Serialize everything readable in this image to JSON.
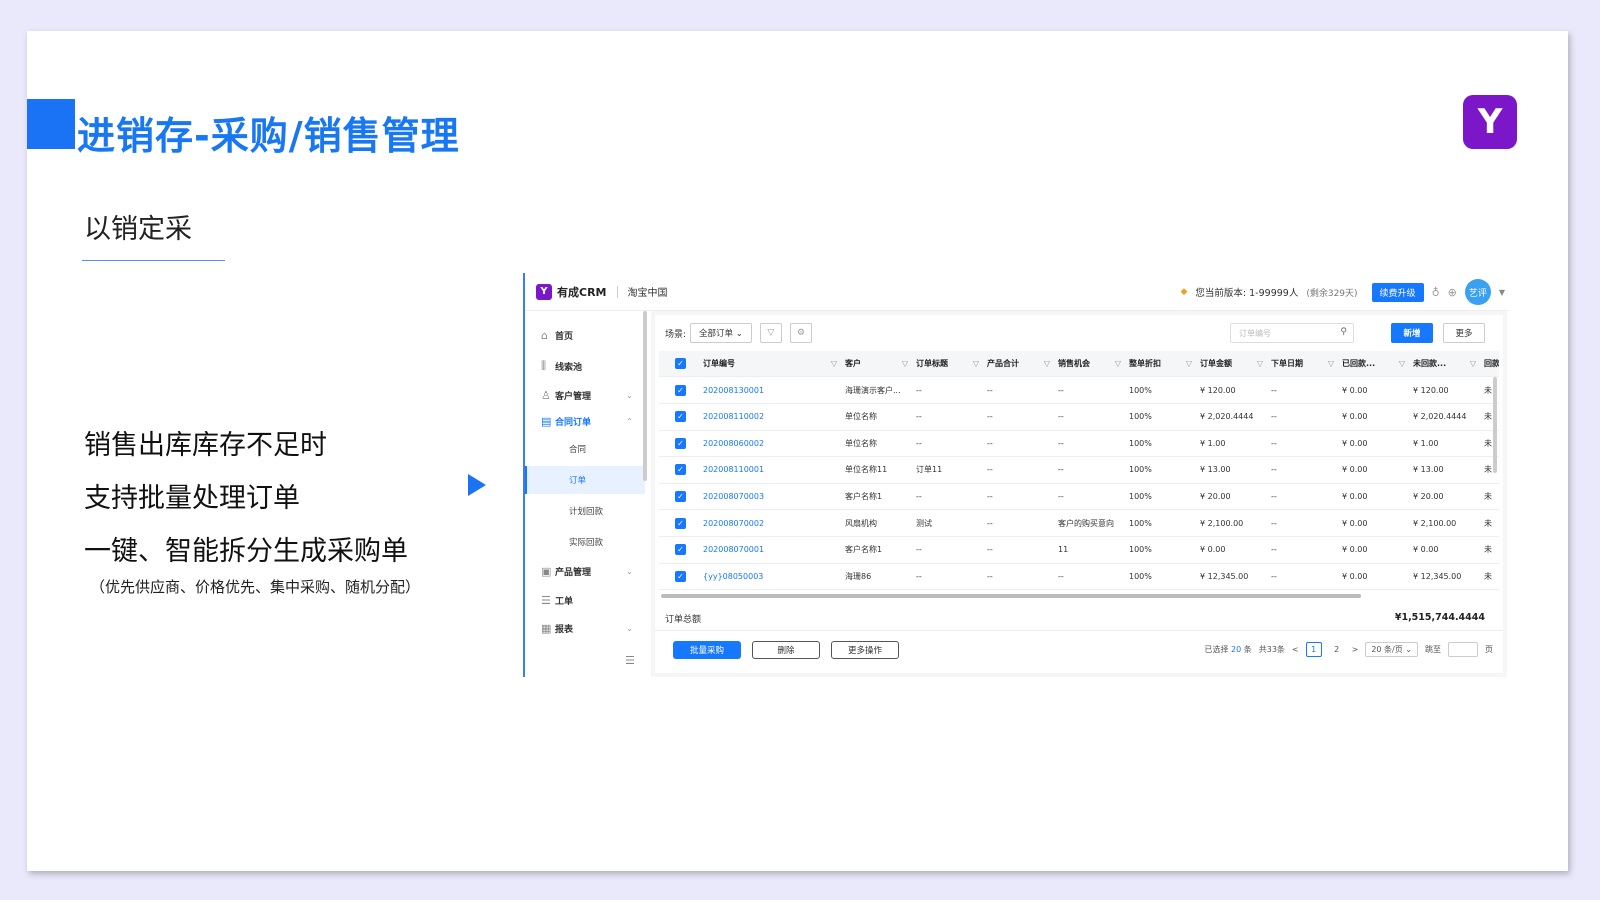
{
  "slide": {
    "title": "进销存-采购/销售管理",
    "logo_glyph": "Y",
    "subheading": "以销定采",
    "bullets": [
      "销售出库库存不足时",
      "支持批量处理订单",
      "一键、智能拆分生成采购单"
    ],
    "note": "（优先供应商、价格优先、集中采购、随机分配）",
    "accent_color": "#1a73f5"
  },
  "app": {
    "name": "有成CRM",
    "logo_glyph": "Y",
    "company": "淘宝中国",
    "version_text": "您当前版本: 1-99999人",
    "version_remaining": "(剩余329天)",
    "upgrade_label": "续费升级",
    "avatar_text": "艺评",
    "icons": [
      "shirt-icon",
      "globe-icon",
      "chevron-down-icon"
    ]
  },
  "sidebar": {
    "items": [
      {
        "label": "首页",
        "icon": "home-icon"
      },
      {
        "label": "线索池",
        "icon": "bars-icon"
      },
      {
        "label": "客户管理",
        "icon": "user-icon"
      },
      {
        "label": "合同订单",
        "icon": "contract-icon"
      },
      {
        "label": "产品管理",
        "icon": "box-icon"
      },
      {
        "label": "工单",
        "icon": "ticket-icon"
      },
      {
        "label": "报表",
        "icon": "chart-icon"
      }
    ],
    "sub_items": [
      {
        "label": "合同"
      },
      {
        "label": "订单"
      },
      {
        "label": "计划回款"
      },
      {
        "label": "实际回款"
      }
    ]
  },
  "filter": {
    "scene_label": "场景:",
    "scene_value": "全部订单",
    "search_placeholder": "订单编号",
    "new_label": "新增",
    "more_label": "更多"
  },
  "table": {
    "headers": [
      "订单编号",
      "客户",
      "订单标题",
      "产品合计",
      "销售机会",
      "整单折扣",
      "订单金额",
      "下单日期",
      "已回款...",
      "未回款...",
      "回款"
    ],
    "rows": [
      [
        "202008130001",
        "海珊演示客户...",
        "--",
        "--",
        "--",
        "100%",
        "¥ 120.00",
        "--",
        "¥ 0.00",
        "¥ 120.00",
        "未"
      ],
      [
        "202008110002",
        "单位名称",
        "--",
        "--",
        "--",
        "100%",
        "¥ 2,020.4444",
        "--",
        "¥ 0.00",
        "¥ 2,020.4444",
        "未"
      ],
      [
        "202008060002",
        "单位名称",
        "--",
        "--",
        "--",
        "100%",
        "¥ 1.00",
        "--",
        "¥ 0.00",
        "¥ 1.00",
        "未"
      ],
      [
        "202008110001",
        "单位名称11",
        "订单11",
        "--",
        "--",
        "100%",
        "¥ 13.00",
        "--",
        "¥ 0.00",
        "¥ 13.00",
        "未"
      ],
      [
        "202008070003",
        "客户名称1",
        "--",
        "--",
        "--",
        "100%",
        "¥ 20.00",
        "--",
        "¥ 0.00",
        "¥ 20.00",
        "未"
      ],
      [
        "202008070002",
        "风扇机构",
        "测试",
        "--",
        "客户的购买意向",
        "100%",
        "¥ 2,100.00",
        "--",
        "¥ 0.00",
        "¥ 2,100.00",
        "未"
      ],
      [
        "202008070001",
        "客户名称1",
        "--",
        "--",
        "11",
        "100%",
        "¥ 0.00",
        "--",
        "¥ 0.00",
        "¥ 0.00",
        "未"
      ],
      [
        "{yy}08050003",
        "海珊86",
        "--",
        "--",
        "--",
        "100%",
        "¥ 12,345.00",
        "--",
        "¥ 0.00",
        "¥ 12,345.00",
        "未"
      ]
    ]
  },
  "totals": {
    "label": "订单总额",
    "value": "¥1,515,744.4444"
  },
  "footer": {
    "batch_purchase_label": "批量采购",
    "delete_label": "删除",
    "more_actions_label": "更多操作",
    "selected_prefix": "已选择",
    "selected_count": "20",
    "selected_unit": "条",
    "total_text": "共33条",
    "pages": [
      "1",
      "2"
    ],
    "page_size": "20 条/页",
    "jump_label": "跳至",
    "page_unit": "页"
  }
}
